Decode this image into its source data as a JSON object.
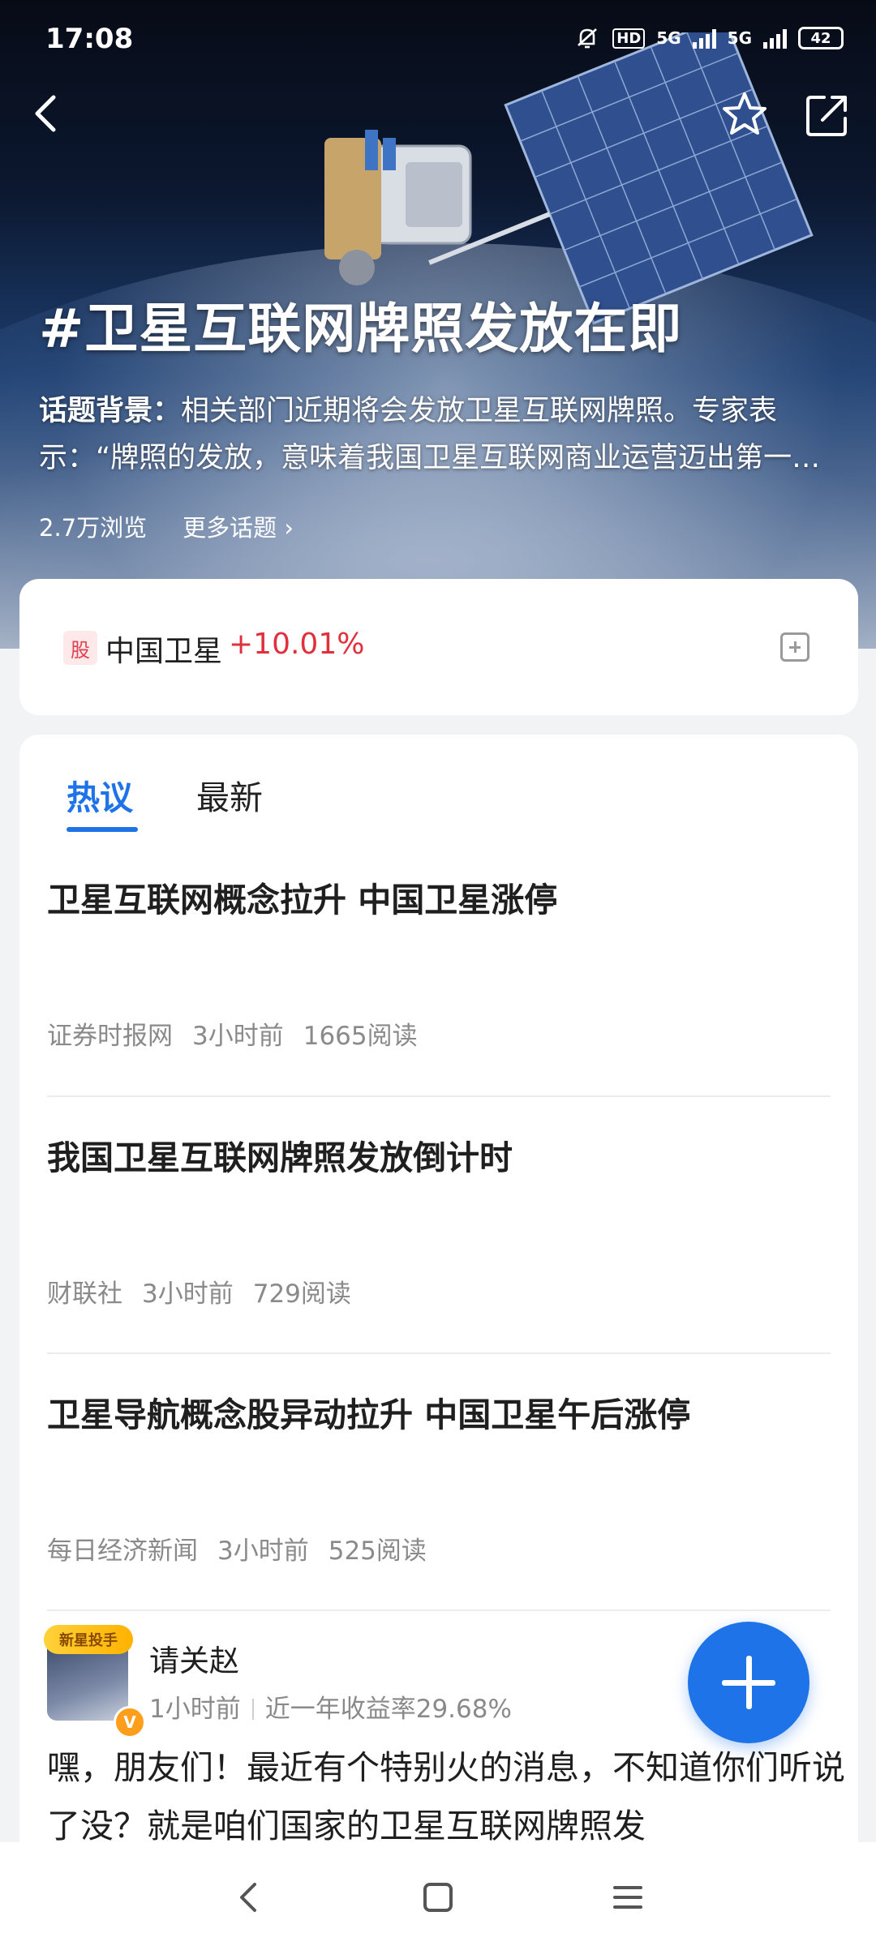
{
  "status_bar": {
    "time": "17:08",
    "network1": "5G",
    "network2": "5G",
    "hd": "HD",
    "battery": "42"
  },
  "hero": {
    "title": "#卫星互联网牌照发放在即",
    "desc_label": "话题背景：",
    "desc_text": "相关部门近期将会发放卫星互联网牌照。专家表示：“牌照的发放，意味着我国卫星互联网商业运营迈出第一步”",
    "views": "2.7万浏览",
    "more_topics": "更多话题",
    "more_arrow": "›"
  },
  "stock": {
    "badge": "股",
    "name": "中国卫星",
    "change": "+10.01%",
    "change_color": "#e0303c"
  },
  "tabs": {
    "hot": "热议",
    "latest": "最新",
    "accent": "#1e73e8"
  },
  "articles": [
    {
      "title": "卫星互联网概念拉升 中国卫星涨停",
      "source": "证券时报网",
      "time": "3小时前",
      "reads": "1665阅读"
    },
    {
      "title": "我国卫星互联网牌照发放倒计时",
      "source": "财联社",
      "time": "3小时前",
      "reads": "729阅读"
    },
    {
      "title": "卫星导航概念股异动拉升 中国卫星午后涨停",
      "source": "每日经济新闻",
      "time": "3小时前",
      "reads": "525阅读"
    }
  ],
  "post": {
    "avatar_badge": "新星投手",
    "verified": "V",
    "author": "请关赵",
    "time": "1小时前",
    "yield": "近一年收益率29.68%",
    "body": "嘿，朋友们！最近有个特别火的消息，不知道你们听说了没？就是咱们国家的卫星互联网牌照发"
  },
  "icons": {
    "back": "back-arrow-icon",
    "star": "star-icon",
    "share": "share-icon",
    "add": "plus-icon"
  }
}
